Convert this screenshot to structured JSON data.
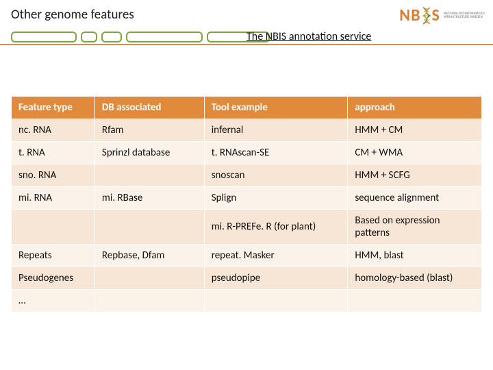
{
  "title": "Other genome features",
  "subtitle": "The NBIS annotation service",
  "logo": {
    "left": "NB",
    "right": "S",
    "sub_line1": "NATIONAL BIOINFORMATICS",
    "sub_line2": "INFRASTRUCTURE SWEDEN"
  },
  "table": {
    "headers": [
      "Feature type",
      "DB associated",
      "Tool example",
      "approach"
    ],
    "rows": [
      [
        "nc. RNA",
        "Rfam",
        "infernal",
        "HMM + CM"
      ],
      [
        "t. RNA",
        "Sprinzl database",
        "t. RNAscan-SE",
        "CM + WMA"
      ],
      [
        "sno. RNA",
        "",
        "snoscan",
        "HMM + SCFG"
      ],
      [
        "mi. RNA",
        "mi. RBase",
        "Splign",
        "sequence alignment"
      ],
      [
        "",
        "",
        "mi. R-PREFe. R (for plant)",
        "Based on expression patterns"
      ],
      [
        "Repeats",
        "Repbase, Dfam",
        "repeat. Masker",
        "HMM, blast"
      ],
      [
        "Pseudogenes",
        "",
        "pseudopipe",
        "homology-based (blast)"
      ],
      [
        "…",
        "",
        "",
        ""
      ]
    ]
  },
  "chart_data": {
    "type": "table",
    "title": "Other genome features",
    "columns": [
      "Feature type",
      "DB associated",
      "Tool example",
      "approach"
    ],
    "rows": [
      {
        "Feature type": "nc. RNA",
        "DB associated": "Rfam",
        "Tool example": "infernal",
        "approach": "HMM + CM"
      },
      {
        "Feature type": "t. RNA",
        "DB associated": "Sprinzl database",
        "Tool example": "t. RNAscan-SE",
        "approach": "CM + WMA"
      },
      {
        "Feature type": "sno. RNA",
        "DB associated": "",
        "Tool example": "snoscan",
        "approach": "HMM + SCFG"
      },
      {
        "Feature type": "mi. RNA",
        "DB associated": "mi. RBase",
        "Tool example": "Splign",
        "approach": "sequence alignment"
      },
      {
        "Feature type": "",
        "DB associated": "",
        "Tool example": "mi. R-PREFe. R (for plant)",
        "approach": "Based on expression patterns"
      },
      {
        "Feature type": "Repeats",
        "DB associated": "Repbase, Dfam",
        "Tool example": "repeat. Masker",
        "approach": "HMM, blast"
      },
      {
        "Feature type": "Pseudogenes",
        "DB associated": "",
        "Tool example": "pseudopipe",
        "approach": "homology-based (blast)"
      },
      {
        "Feature type": "…",
        "DB associated": "",
        "Tool example": "",
        "approach": ""
      }
    ]
  }
}
